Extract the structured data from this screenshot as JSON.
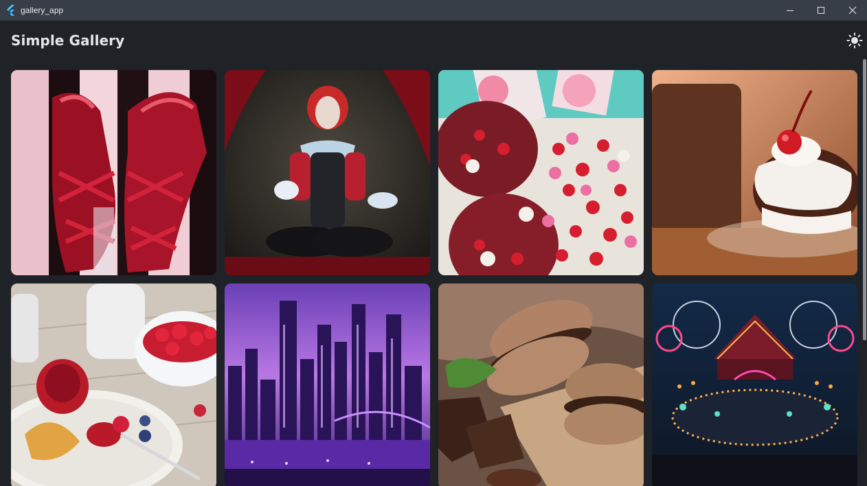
{
  "window": {
    "title": "gallery_app",
    "icons": {
      "logo": "flutter-logo-icon",
      "minimize": "minimize-icon",
      "maximize": "maximize-icon",
      "close": "close-icon"
    }
  },
  "appbar": {
    "title": "Simple Gallery",
    "theme_toggle_icon": "sun-icon"
  },
  "gallery": {
    "images": [
      {
        "subject": "red-lace-up-boots"
      },
      {
        "subject": "clown-cosplay-portrait"
      },
      {
        "subject": "red-velvet-cookies-and-candies"
      },
      {
        "subject": "cherry-chocolate-cake"
      },
      {
        "subject": "raspberry-jam-breakfast"
      },
      {
        "subject": "purple-city-skyline"
      },
      {
        "subject": "chocolate-macarons"
      },
      {
        "subject": "neon-circus-carnival"
      }
    ]
  },
  "colors": {
    "background": "#1f2227",
    "titlebar": "#383e47",
    "text": "#e4e6ea",
    "flutter_blue": "#47c5fb"
  }
}
